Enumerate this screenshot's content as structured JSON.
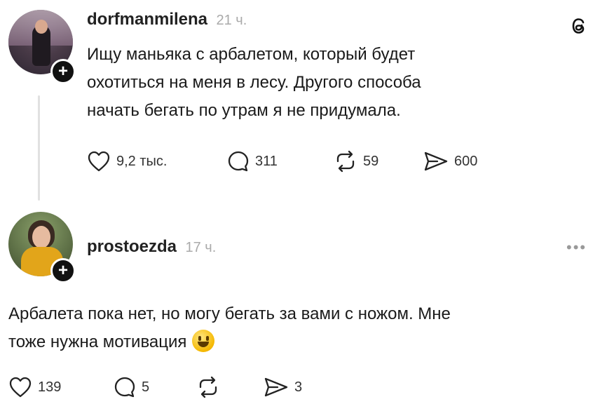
{
  "post1": {
    "username": "dorfmanmilena",
    "time": "21 ч.",
    "text_lines": [
      "Ищу маньяка с арбалетом, который будет",
      "охотиться на меня в лесу. Другого способа",
      "начать бегать по утрам я не придумала."
    ],
    "likes": "9,2 тыс.",
    "comments": "311",
    "reposts": "59",
    "shares": "600"
  },
  "post2": {
    "username": "prostoezda",
    "time": "17 ч.",
    "text_lines": [
      "Арбалета пока нет, но могу бегать за вами с ножом. Мне",
      "тоже нужна мотивация"
    ],
    "likes": "139",
    "comments": "5",
    "shares": "3"
  },
  "icons": {
    "app_logo": "threads-logo-icon",
    "like": "heart-icon",
    "comment": "speech-bubble-icon",
    "repost": "repost-arrows-icon",
    "share": "send-plane-icon",
    "follow": "plus-icon",
    "more": "more-dots-icon"
  },
  "colors": {
    "text": "#111111",
    "muted": "#aaaaaa",
    "thread_line": "#e1e1e1"
  }
}
